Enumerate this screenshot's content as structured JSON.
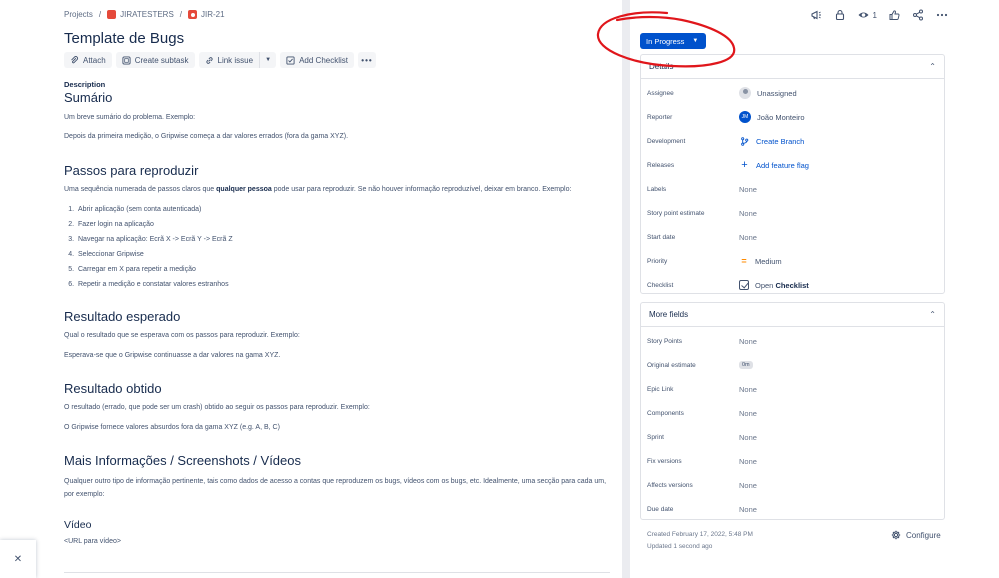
{
  "breadcrumb": {
    "projects": "Projects",
    "sep": "/",
    "project": "JIRATESTERS",
    "issue": "JIR-21"
  },
  "issue": {
    "title": "Template de Bugs"
  },
  "toolbar": {
    "attach": "Attach",
    "create_subtask": "Create subtask",
    "link_issue": "Link issue",
    "add_checklist": "Add Checklist",
    "more": "•••"
  },
  "description": {
    "label": "Description",
    "sumario": {
      "heading": "Sumário",
      "p1": "Um breve sumário do problema. Exemplo:",
      "p2": "Depois da primeira medição, o Gripwise começa a dar valores errados (fora da gama XYZ)."
    },
    "passos": {
      "heading": "Passos para reproduzir",
      "p_before": "Uma sequência numerada de passos claros que ",
      "p_bold": "qualquer pessoa",
      "p_after": " pode usar para reproduzir. Se não houver informação reproduzível, deixar em branco. Exemplo:",
      "steps": [
        "Abrir aplicação (sem conta autenticada)",
        "Fazer login na aplicação",
        "Navegar na aplicação: Ecrã X -> Ecrã Y -> Ecrã Z",
        "Seleccionar Gripwise",
        "Carregar em X para repetir a medição",
        "Repetir a medição e constatar valores estranhos"
      ]
    },
    "esperado": {
      "heading": "Resultado esperado",
      "p1": "Qual o resultado que se esperava com os passos para reproduzir. Exemplo:",
      "p2": "Esperava-se que o Gripwise continuasse a dar valores na gama XYZ."
    },
    "obtido": {
      "heading": "Resultado obtido",
      "p1": "O resultado (errado, que pode ser um crash) obtido ao seguir os passos para reproduzir. Exemplo:",
      "p2": "O Gripwise fornece valores absurdos fora da gama XYZ (e.g. A, B, C)"
    },
    "mais": {
      "heading": "Mais Informações / Screenshots / Vídeos",
      "p1": "Qualquer outro tipo de informação pertinente, tais como dados de acesso a contas que reproduzem os bugs, vídeos com os bugs, etc. Idealmente, uma secção para cada um, por exemplo:"
    },
    "video": {
      "heading": "Vídeo",
      "p1": "<URL para vídeo>"
    }
  },
  "header_actions": {
    "watch_count": "1"
  },
  "status": {
    "label": "In Progress"
  },
  "details": {
    "heading": "Details",
    "fields": {
      "assignee": {
        "label": "Assignee",
        "value": "Unassigned"
      },
      "reporter": {
        "label": "Reporter",
        "value": "João Monteiro",
        "initials": "JM"
      },
      "development": {
        "label": "Development",
        "value": "Create Branch"
      },
      "releases": {
        "label": "Releases",
        "value": "Add feature flag"
      },
      "labels": {
        "label": "Labels",
        "value": "None"
      },
      "story_point_estimate": {
        "label": "Story point estimate",
        "value": "None"
      },
      "start_date": {
        "label": "Start date",
        "value": "None"
      },
      "priority": {
        "label": "Priority",
        "value": "Medium"
      },
      "checklist": {
        "label": "Checklist",
        "value_prefix": "Open ",
        "value_bold": "Checklist"
      }
    }
  },
  "more_fields": {
    "heading": "More fields",
    "fields": {
      "story_points": {
        "label": "Story Points",
        "value": "None"
      },
      "original_estimate": {
        "label": "Original estimate",
        "value": "0m"
      },
      "epic_link": {
        "label": "Epic Link",
        "value": "None"
      },
      "components": {
        "label": "Components",
        "value": "None"
      },
      "sprint": {
        "label": "Sprint",
        "value": "None"
      },
      "fix_versions": {
        "label": "Fix versions",
        "value": "None"
      },
      "affects_versions": {
        "label": "Affects versions",
        "value": "None"
      },
      "due_date": {
        "label": "Due date",
        "value": "None"
      }
    }
  },
  "meta": {
    "created": "Created February 17, 2022, 5:48 PM",
    "updated": "Updated 1 second ago",
    "configure": "Configure"
  },
  "colors": {
    "accent": "#0052cc",
    "annotation": "#e0161b",
    "priority_medium": "#ff8b00",
    "bug": "#e5493a"
  }
}
